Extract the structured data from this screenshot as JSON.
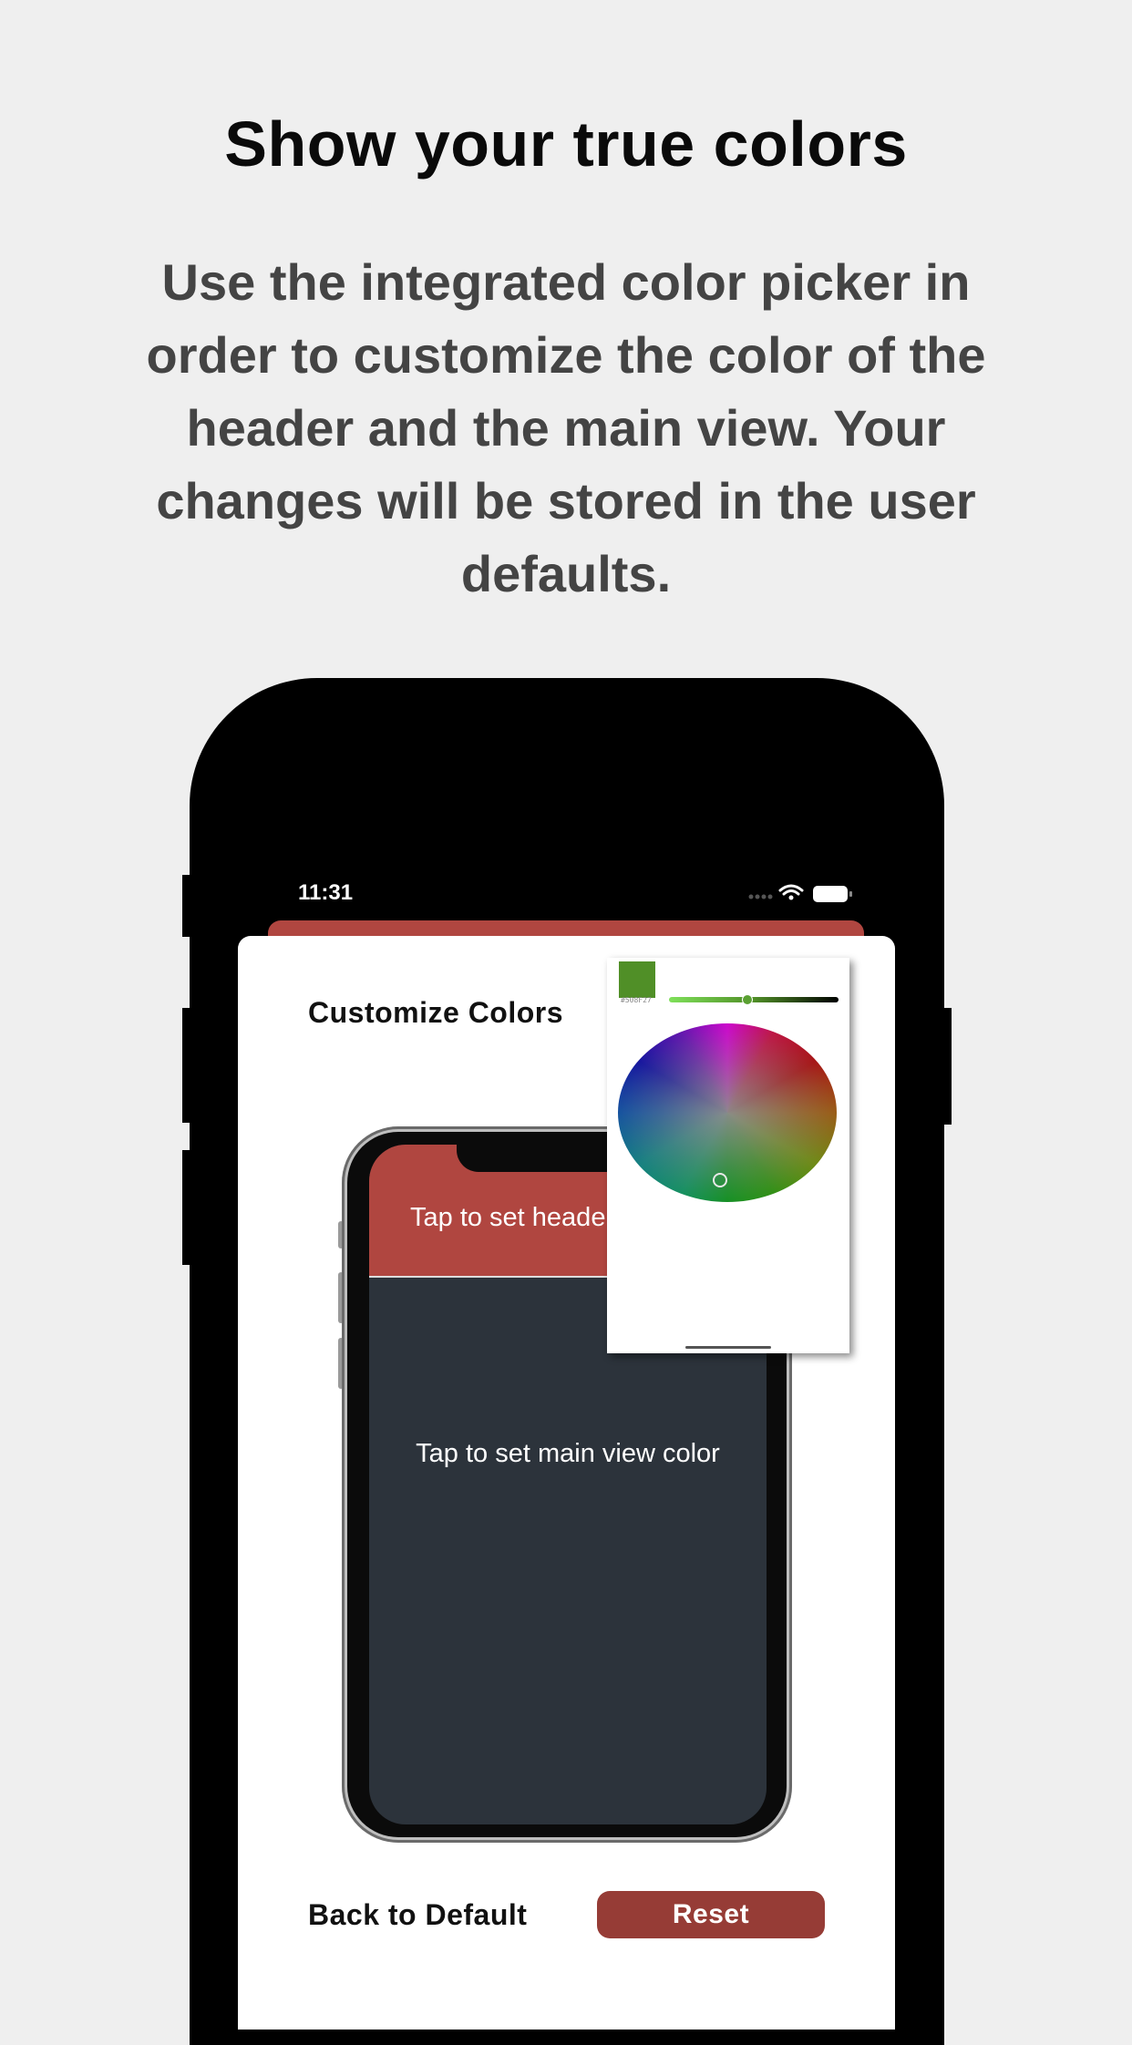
{
  "headline": "Show your true colors",
  "subtitle": "Use the integrated color picker in order to customize the color of the header and the main view. Your changes will be stored in the user defaults.",
  "status_bar": {
    "time": "11:31",
    "icons": [
      "signal-icon",
      "wifi-icon",
      "battery-icon"
    ]
  },
  "sheet": {
    "title": "Customize Colors",
    "mockup": {
      "header_text": "Tap to set header color",
      "main_text": "Tap to set main view color"
    },
    "back_default_label": "Back to Default",
    "reset_label": "Reset"
  },
  "color_picker": {
    "selected_color": "#508f27",
    "hex_label": "#508F27"
  },
  "colors": {
    "header_red": "#b04640",
    "main_view": "#2c333b",
    "reset_button": "#963c36",
    "background": "#efefef"
  }
}
